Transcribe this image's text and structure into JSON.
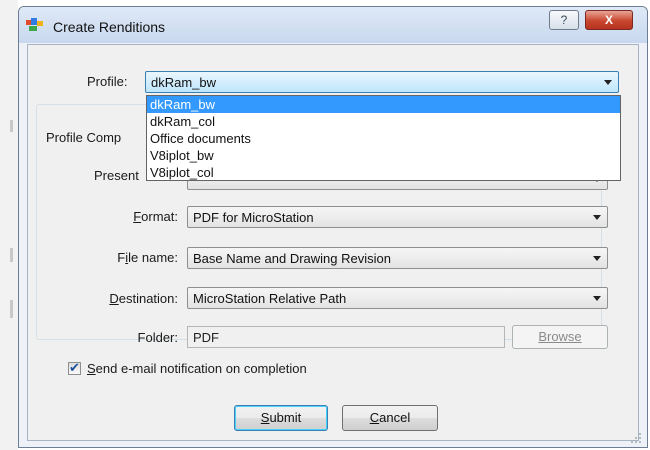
{
  "window": {
    "title": "Create Renditions",
    "help_label": "?",
    "close_label": "X"
  },
  "profile": {
    "label": "Profile:",
    "selected": "dkRam_bw",
    "options": [
      "dkRam_bw",
      "dkRam_col",
      "Office documents",
      "V8iplot_bw",
      "V8iplot_col"
    ],
    "highlighted_option": "dkRam_bw"
  },
  "group": {
    "title": "Profile Comp",
    "presentation_label": "Present",
    "format_label": "Format:",
    "format_value": "PDF for MicroStation",
    "filename_label": "File name:",
    "filename_value": "Base Name and Drawing Revision",
    "destination_label": "Destination:",
    "destination_value": "MicroStation Relative Path",
    "folder_label": "Folder:",
    "folder_value": "PDF",
    "browse_label": "Browse",
    "notify_label": "Send e-mail notification on completion",
    "notify_checked": true
  },
  "buttons": {
    "submit": "Submit",
    "cancel": "Cancel"
  },
  "colors": {
    "selection": "#3399ff",
    "close_button": "#c9462f",
    "title_bar": "#c8d8ee"
  }
}
